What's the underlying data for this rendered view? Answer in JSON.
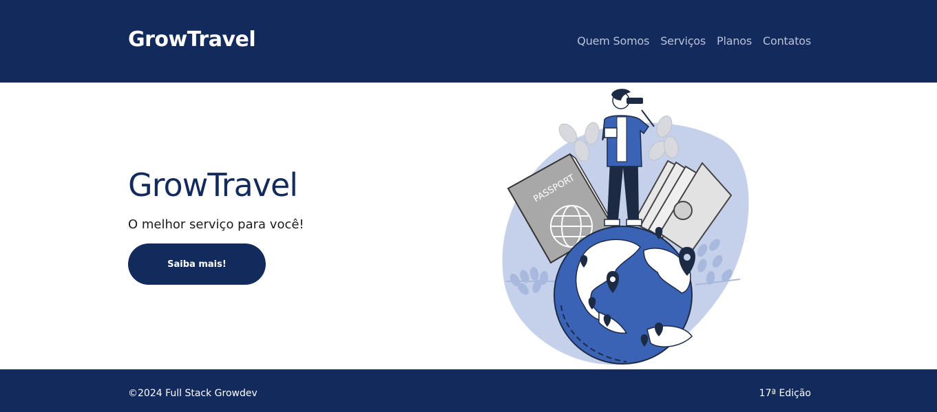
{
  "header": {
    "brand": "GrowTravel",
    "nav": [
      {
        "label": "Quem Somos"
      },
      {
        "label": "Serviços"
      },
      {
        "label": "Planos"
      },
      {
        "label": "Contatos"
      }
    ]
  },
  "hero": {
    "title": "GrowTravel",
    "subtitle": "O melhor serviço para você!",
    "cta_label": "Saiba mais!",
    "illustration": {
      "icon": "traveler-globe-illustration",
      "passport_text": "PASSPORT"
    }
  },
  "footer": {
    "copyright": "©2024 Full Stack Growdev",
    "edition": "17ª Edição"
  },
  "colors": {
    "primary": "#132a5c",
    "nav_text": "#b9c2d8",
    "accent_blue": "#3a62b5",
    "light_blob": "#c5d0ea"
  }
}
